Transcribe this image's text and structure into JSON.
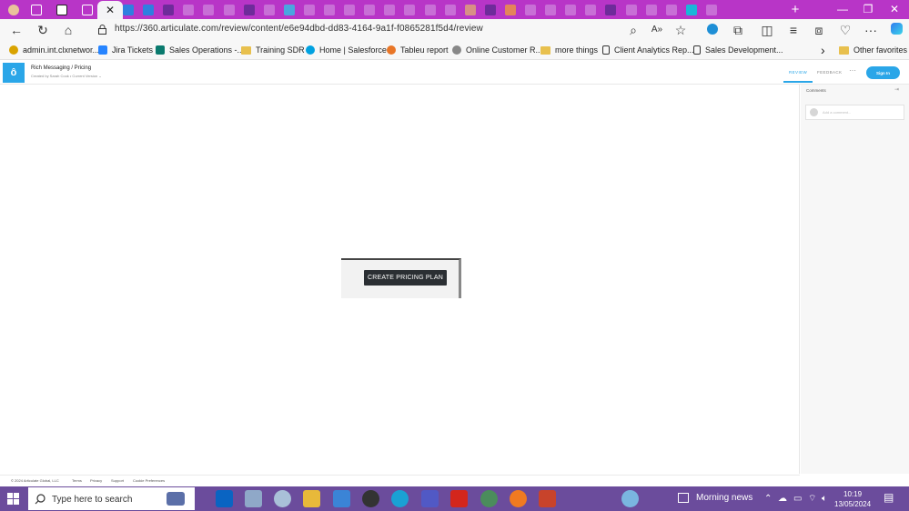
{
  "browser": {
    "url": "https://360.articulate.com/review/content/e6e94dbd-dd83-4164-9a1f-f0865281f5d4/review",
    "close_glyph": "✕",
    "new_tab_glyph": "+",
    "tab_icons": [
      "profile-avatar",
      "workspaces-icon",
      "tab-actions-icon",
      "page-icon",
      "page-icon",
      "page-icon",
      "page-icon",
      "page-icon",
      "page-icon",
      "page-icon",
      "page-icon",
      "page-icon",
      "page-icon",
      "page-icon",
      "page-icon",
      "page-icon",
      "page-icon",
      "page-icon",
      "page-icon",
      "page-icon",
      "page-icon",
      "page-icon",
      "page-icon",
      "page-icon",
      "page-icon",
      "page-icon",
      "page-icon",
      "page-icon",
      "page-icon",
      "page-icon",
      "page-icon",
      "page-icon",
      "page-icon",
      "page-icon",
      "page-icon",
      "page-icon",
      "page-icon"
    ],
    "window_controls": {
      "minimize": "—",
      "restore": "❐",
      "close": "✕"
    }
  },
  "bookmarks": [
    {
      "label": "admin.int.clxnetwor...",
      "icon": "site-icon"
    },
    {
      "label": "Jira Tickets",
      "icon": "jira-icon"
    },
    {
      "label": "Sales Operations -...",
      "icon": "sharepoint-icon"
    },
    {
      "label": "Training SDR",
      "icon": "folder-icon"
    },
    {
      "label": "Home | Salesforce",
      "icon": "salesforce-icon"
    },
    {
      "label": "Tableu report",
      "icon": "tableau-icon"
    },
    {
      "label": "Online Customer R...",
      "icon": "gear-icon"
    },
    {
      "label": "more things",
      "icon": "folder-icon"
    },
    {
      "label": "Client Analytics Rep...",
      "icon": "page-icon"
    },
    {
      "label": "Sales Development...",
      "icon": "page-icon"
    }
  ],
  "bookmarks_overflow": "›",
  "other_favorites": "Other favorites",
  "app": {
    "logo": "ô",
    "title": "Rich Messaging / Pricing",
    "subtitle": "Created by Sarah Cook  •  Current Version ⌄",
    "tab_review": "REVIEW",
    "tab_feedback": "FEEDBACK",
    "more": "···",
    "sign_in": "Sign In"
  },
  "slide": {
    "button_label": "CREATE PRICING PLAN"
  },
  "comments": {
    "title": "Comments",
    "collapse": "⇥",
    "placeholder": "Add a comment..."
  },
  "footer": {
    "copyright": "© 2024 Articulate Global, LLC",
    "links": [
      "Terms",
      "Privacy",
      "Support",
      "Cookie Preferences"
    ]
  },
  "taskbar": {
    "search_placeholder": "Type here to search",
    "weather": "Morning news",
    "time": "10:19",
    "date": "13/05/2024"
  },
  "colors": {
    "tabbar": "#b835c7",
    "accent": "#2aa6e8",
    "taskbar": "#6b4c9c",
    "button_dark": "#2b2f33"
  }
}
